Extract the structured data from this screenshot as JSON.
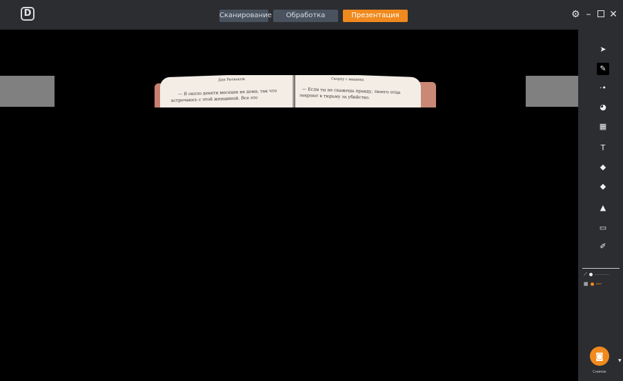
{
  "app": {
    "logo_letter": "D"
  },
  "tabs": [
    {
      "label": "Сканирование",
      "active": false
    },
    {
      "label": "Обработка",
      "active": false
    },
    {
      "label": "Презентация",
      "active": true
    }
  ],
  "colors": {
    "accent": "#f08a1e",
    "tab_bg": "#4a5260",
    "titlebar": "#2b2d31",
    "stage": "#000000"
  },
  "book": {
    "left_header": "Дин Рютвекеж",
    "left_line1": "— Я около девяти месяцев не дома, так что",
    "left_line2": "встречаюсь с этой женщиной. Все это",
    "right_header": "Скорпу с машины",
    "right_line1": "— Если ты не скажешь правду, твоего отца",
    "right_line2": "закроют в тюрьму за убийство."
  },
  "tools": [
    {
      "name": "pointer-icon",
      "glyph": "➤",
      "selected": false
    },
    {
      "name": "pen-icon",
      "glyph": "✎",
      "selected": true
    },
    {
      "name": "laser-pointer-icon",
      "glyph": "·•",
      "selected": false
    },
    {
      "name": "spotlight-icon",
      "glyph": "◕",
      "selected": false
    },
    {
      "name": "shade-icon",
      "glyph": "▦",
      "selected": false
    },
    {
      "name": "text-icon",
      "glyph": "T",
      "selected": false
    },
    {
      "name": "fill-icon",
      "glyph": "◆",
      "selected": false
    },
    {
      "name": "eraser-icon",
      "glyph": "◆",
      "selected": false
    },
    {
      "name": "clear-all-icon",
      "glyph": "▲",
      "selected": false
    },
    {
      "name": "board-icon",
      "glyph": "▭",
      "selected": false
    },
    {
      "name": "color-picker-icon",
      "glyph": "✐",
      "selected": false
    }
  ],
  "tool_options": {
    "line_label": "——————",
    "color_label": "Цвет"
  },
  "capture": {
    "label": "Снимок"
  }
}
